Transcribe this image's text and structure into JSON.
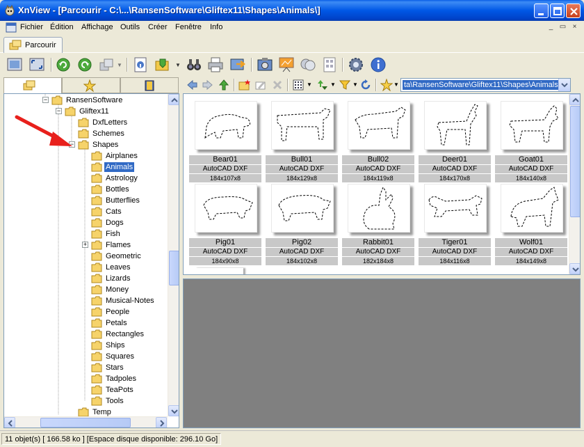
{
  "window": {
    "title": "XnView - [Parcourir - C:\\...\\RansenSoftware\\Gliftex11\\Shapes\\Animals\\]"
  },
  "menu": {
    "items": [
      "Fichier",
      "Édition",
      "Affichage",
      "Outils",
      "Créer",
      "Fenêtre",
      "Info"
    ]
  },
  "tabs": {
    "browse_label": "Parcourir"
  },
  "address": {
    "path": "ta\\RansenSoftware\\Gliftex11\\Shapes\\Animals\\"
  },
  "tree": {
    "nodes": [
      "RansenSoftware",
      "Gliftex11",
      "DxfLetters",
      "Schemes",
      "Shapes",
      "Airplanes",
      "Animals",
      "Astrology",
      "Bottles",
      "Butterflies",
      "Cats",
      "Dogs",
      "Fish",
      "Flames",
      "Geometric",
      "Leaves",
      "Lizards",
      "Money",
      "Musical-Notes",
      "People",
      "Petals",
      "Rectangles",
      "Ships",
      "Squares",
      "Stars",
      "Tadpoles",
      "TeaPots",
      "Tools",
      "Temp"
    ],
    "selected": "Animals"
  },
  "thumbnails": [
    {
      "name": "Bear01",
      "type": "AutoCAD DXF",
      "dims": "184x107x8"
    },
    {
      "name": "Bull01",
      "type": "AutoCAD DXF",
      "dims": "184x129x8"
    },
    {
      "name": "Bull02",
      "type": "AutoCAD DXF",
      "dims": "184x119x8"
    },
    {
      "name": "Deer01",
      "type": "AutoCAD DXF",
      "dims": "184x170x8"
    },
    {
      "name": "Goat01",
      "type": "AutoCAD DXF",
      "dims": "184x140x8"
    },
    {
      "name": "Pig01",
      "type": "AutoCAD DXF",
      "dims": "184x90x8"
    },
    {
      "name": "Pig02",
      "type": "AutoCAD DXF",
      "dims": "184x102x8"
    },
    {
      "name": "Rabbit01",
      "type": "AutoCAD DXF",
      "dims": "182x184x8"
    },
    {
      "name": "Tiger01",
      "type": "AutoCAD DXF",
      "dims": "184x116x8"
    },
    {
      "name": "Wolf01",
      "type": "AutoCAD DXF",
      "dims": "184x149x8"
    }
  ],
  "status": {
    "text": "11 objet(s) [ 166.58 ko ] [Espace disque disponible: 296.10 Go]"
  },
  "colors": {
    "title_bar": "#0058e6",
    "selection": "#316ac5",
    "preview_bg": "#808080"
  }
}
